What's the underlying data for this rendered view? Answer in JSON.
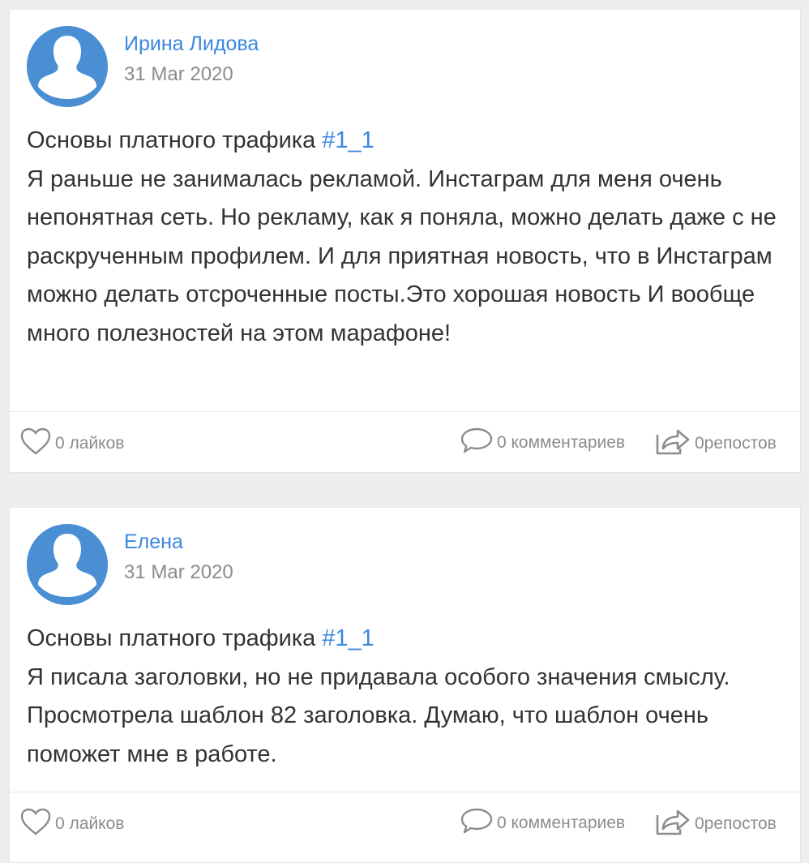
{
  "posts": [
    {
      "author": "Ирина Лидова",
      "date": "31 Mar 2020",
      "title": "Основы платного трафика ",
      "hashtag": "#1_1",
      "text": "Я раньше не занималась рекламой. Инстаграм для меня очень непонятная сеть. Но рекламу, как я поняла, можно делать даже с не раскрученным профилем. И для приятная новость, что в Инстаграм можно делать отсроченные посты.Это хорошая новость  И вообще много полезностей на этом марафоне!",
      "likes": "0 лайков",
      "comments": "0 комментариев",
      "reposts": "0репостов"
    },
    {
      "author": "Елена",
      "date": "31 Mar 2020",
      "title": "Основы платного трафика ",
      "hashtag": "#1_1",
      "text": "Я писала заголовки, но не придавала особого значения смыслу. Просмотрела шаблон 82 заголовка. Думаю, что шаблон очень поможет мне в работе.",
      "likes": "0 лайков",
      "comments": "0 комментариев",
      "reposts": "0репостов"
    }
  ],
  "icons": {
    "avatar": "user-silhouette-icon",
    "like": "heart-icon",
    "comment": "speech-bubble-icon",
    "repost": "share-arrow-icon"
  },
  "colors": {
    "accent": "#3b87e0",
    "avatar_bg": "#4a8fd4",
    "muted": "#8c8c8c",
    "text": "#333333",
    "page_bg": "#eeeeee"
  }
}
